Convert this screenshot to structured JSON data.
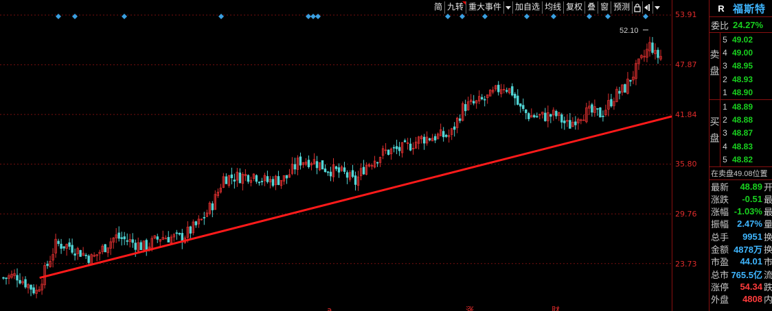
{
  "toolbar": {
    "items": [
      "简",
      "九转",
      "重大事件",
      "加自选",
      "均线",
      "复权",
      "叠",
      "窗",
      "预测"
    ]
  },
  "price_axis": [
    "53.91",
    "47.87",
    "41.84",
    "35.80",
    "29.76",
    "23.73"
  ],
  "chart_data": {
    "type": "candlestick",
    "ylim": [
      17.7,
      53.91
    ],
    "y_ticks": [
      53.91,
      47.87,
      41.84,
      35.8,
      29.76,
      23.73
    ],
    "high_annotation": "52.10",
    "trendline": [
      [
        0.059,
        22.0
      ],
      [
        1.0,
        41.6
      ]
    ],
    "path": [
      [
        0.0,
        22.0
      ],
      [
        0.02,
        22.3
      ],
      [
        0.05,
        20.3
      ],
      [
        0.08,
        26.1
      ],
      [
        0.1,
        25.9
      ],
      [
        0.135,
        24.3
      ],
      [
        0.17,
        27.0
      ],
      [
        0.19,
        26.5
      ],
      [
        0.215,
        25.7
      ],
      [
        0.24,
        27.0
      ],
      [
        0.27,
        26.8
      ],
      [
        0.3,
        28.8
      ],
      [
        0.32,
        31.2
      ],
      [
        0.335,
        34.2
      ],
      [
        0.36,
        34.3
      ],
      [
        0.38,
        34.6
      ],
      [
        0.4,
        33.7
      ],
      [
        0.43,
        34.1
      ],
      [
        0.45,
        36.2
      ],
      [
        0.47,
        36.3
      ],
      [
        0.49,
        35.3
      ],
      [
        0.52,
        34.6
      ],
      [
        0.535,
        33.5
      ],
      [
        0.55,
        35.6
      ],
      [
        0.58,
        37.3
      ],
      [
        0.61,
        37.7
      ],
      [
        0.635,
        38.9
      ],
      [
        0.66,
        39.2
      ],
      [
        0.68,
        39.3
      ],
      [
        0.7,
        42.8
      ],
      [
        0.72,
        43.2
      ],
      [
        0.74,
        44.0
      ],
      [
        0.76,
        45.4
      ],
      [
        0.775,
        44.5
      ],
      [
        0.785,
        42.6
      ],
      [
        0.8,
        41.7
      ],
      [
        0.82,
        41.6
      ],
      [
        0.84,
        41.8
      ],
      [
        0.86,
        40.4
      ],
      [
        0.875,
        41.8
      ],
      [
        0.89,
        42.1
      ],
      [
        0.91,
        41.9
      ],
      [
        0.93,
        44.1
      ],
      [
        0.945,
        45.0
      ],
      [
        0.96,
        47.0
      ],
      [
        0.975,
        48.9
      ],
      [
        0.985,
        50.5
      ],
      [
        0.992,
        48.9
      ]
    ],
    "markers": {
      "top_diamonds": 15,
      "bottom_letters": [
        "a",
        "涨",
        "财"
      ]
    }
  },
  "side": {
    "badge": "R",
    "name": "福斯特",
    "weibi_label": "委比",
    "weibi_value": "24.27%",
    "sell_label": "卖盘",
    "buy_label": "买盘",
    "sell": [
      {
        "lv": "5",
        "px": "49.02"
      },
      {
        "lv": "4",
        "px": "49.00"
      },
      {
        "lv": "3",
        "px": "48.95"
      },
      {
        "lv": "2",
        "px": "48.93"
      },
      {
        "lv": "1",
        "px": "48.90"
      }
    ],
    "buy": [
      {
        "lv": "1",
        "px": "48.89"
      },
      {
        "lv": "2",
        "px": "48.88"
      },
      {
        "lv": "3",
        "px": "48.87"
      },
      {
        "lv": "4",
        "px": "48.83"
      },
      {
        "lv": "5",
        "px": "48.82"
      }
    ],
    "position_text": "在卖盘49.08位置",
    "stats": [
      {
        "k": "最新",
        "v": "48.89",
        "x": "开",
        "color": "g"
      },
      {
        "k": "涨跌",
        "v": "-0.51",
        "x": "最",
        "color": "g"
      },
      {
        "k": "涨幅",
        "v": "-1.03%",
        "x": "最",
        "color": "g"
      },
      {
        "k": "振幅",
        "v": "2.47%",
        "x": "量",
        "color": "c"
      },
      {
        "k": "总手",
        "v": "9951",
        "x": "换",
        "color": "c"
      },
      {
        "k": "金额",
        "v": "4878万",
        "x": "换",
        "color": "c"
      },
      {
        "k": "市盈",
        "v": "44.01",
        "x": "市",
        "color": "c"
      },
      {
        "k": "总市",
        "v": "765.5亿",
        "x": "流",
        "color": "c"
      },
      {
        "k": "涨停",
        "v": "54.34",
        "x": "跌",
        "color": "rd"
      },
      {
        "k": "外盘",
        "v": "4808",
        "x": "内",
        "color": "rd"
      }
    ]
  },
  "colors": {
    "up": "#e03030",
    "down": "#52d6d6",
    "trend": "#ff1a1a",
    "diamond": "#3a9fe0",
    "grid": "#7a0f0f",
    "green": "#19d11f",
    "cyan": "#3fb6ff"
  }
}
